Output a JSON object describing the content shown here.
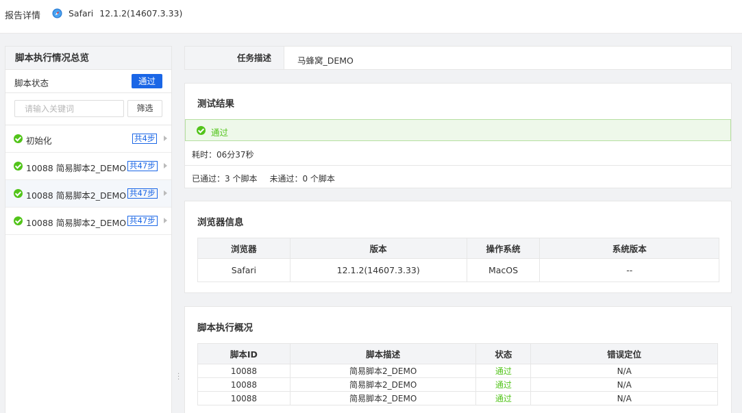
{
  "header": {
    "title": "报告详情",
    "browser_name": "Safari",
    "browser_version": "12.1.2(14607.3.33)"
  },
  "sidebar": {
    "title": "脚本执行情况总览",
    "status_label": "脚本状态",
    "status_badge": "通过",
    "search_placeholder": "请输入关键词",
    "filter_button": "筛选",
    "items": [
      {
        "name": "初始化",
        "steps": "共4步"
      },
      {
        "name": "10088 简易脚本2_DEMO",
        "steps": "共47步"
      },
      {
        "name": "10088 简易脚本2_DEMO",
        "steps": "共47步"
      },
      {
        "name": "10088 简易脚本2_DEMO",
        "steps": "共47步"
      }
    ]
  },
  "task": {
    "label": "任务描述",
    "value": "马蜂窝_DEMO"
  },
  "result": {
    "title": "测试结果",
    "status": "通过",
    "duration": "耗时：06分37秒",
    "passed": "已通过：3 个脚本",
    "failed": "未通过：0 个脚本"
  },
  "browser_info": {
    "title": "浏览器信息",
    "columns": [
      "浏览器",
      "版本",
      "操作系统",
      "系统版本"
    ],
    "row": [
      "Safari",
      "12.1.2(14607.3.33)",
      "MacOS",
      "--"
    ]
  },
  "script_overview": {
    "title": "脚本执行概况",
    "columns": [
      "脚本ID",
      "脚本描述",
      "状态",
      "错误定位"
    ],
    "rows": [
      [
        "10088",
        "简易脚本2_DEMO",
        "通过",
        "N/A"
      ],
      [
        "10088",
        "简易脚本2_DEMO",
        "通过",
        "N/A"
      ],
      [
        "10088",
        "简易脚本2_DEMO",
        "通过",
        "N/A"
      ]
    ]
  }
}
